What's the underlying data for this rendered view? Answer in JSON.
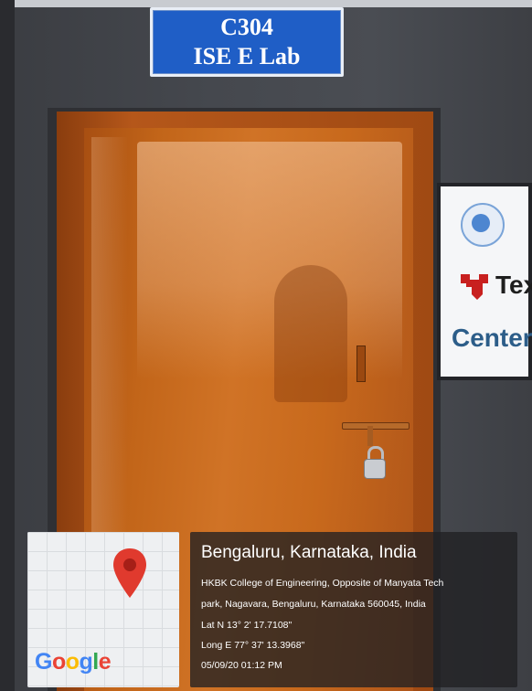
{
  "sign_plate": {
    "line1": "C304",
    "line2": "ISE E Lab"
  },
  "wall_sign": {
    "text_top": "Tex",
    "text_bottom": "Center",
    "logo": "ti-logo"
  },
  "map": {
    "brand": "Google",
    "icon": "location-pin-icon"
  },
  "location": {
    "city": "Bengaluru, Karnataka, India",
    "address_line1": "HKBK College of Engineering, Opposite of Manyata Tech",
    "address_line2": "park, Nagavara, Bengaluru, Karnataka 560045, India",
    "latitude": "Lat N 13° 2' 17.7108\"",
    "longitude": "Long E 77° 37' 13.3968\"",
    "timestamp": "05/09/20 01:12 PM"
  },
  "colors": {
    "door": "#c8691c",
    "plate": "#1f5ec6",
    "wall": "#45484e",
    "pin": "#e03a2e"
  }
}
